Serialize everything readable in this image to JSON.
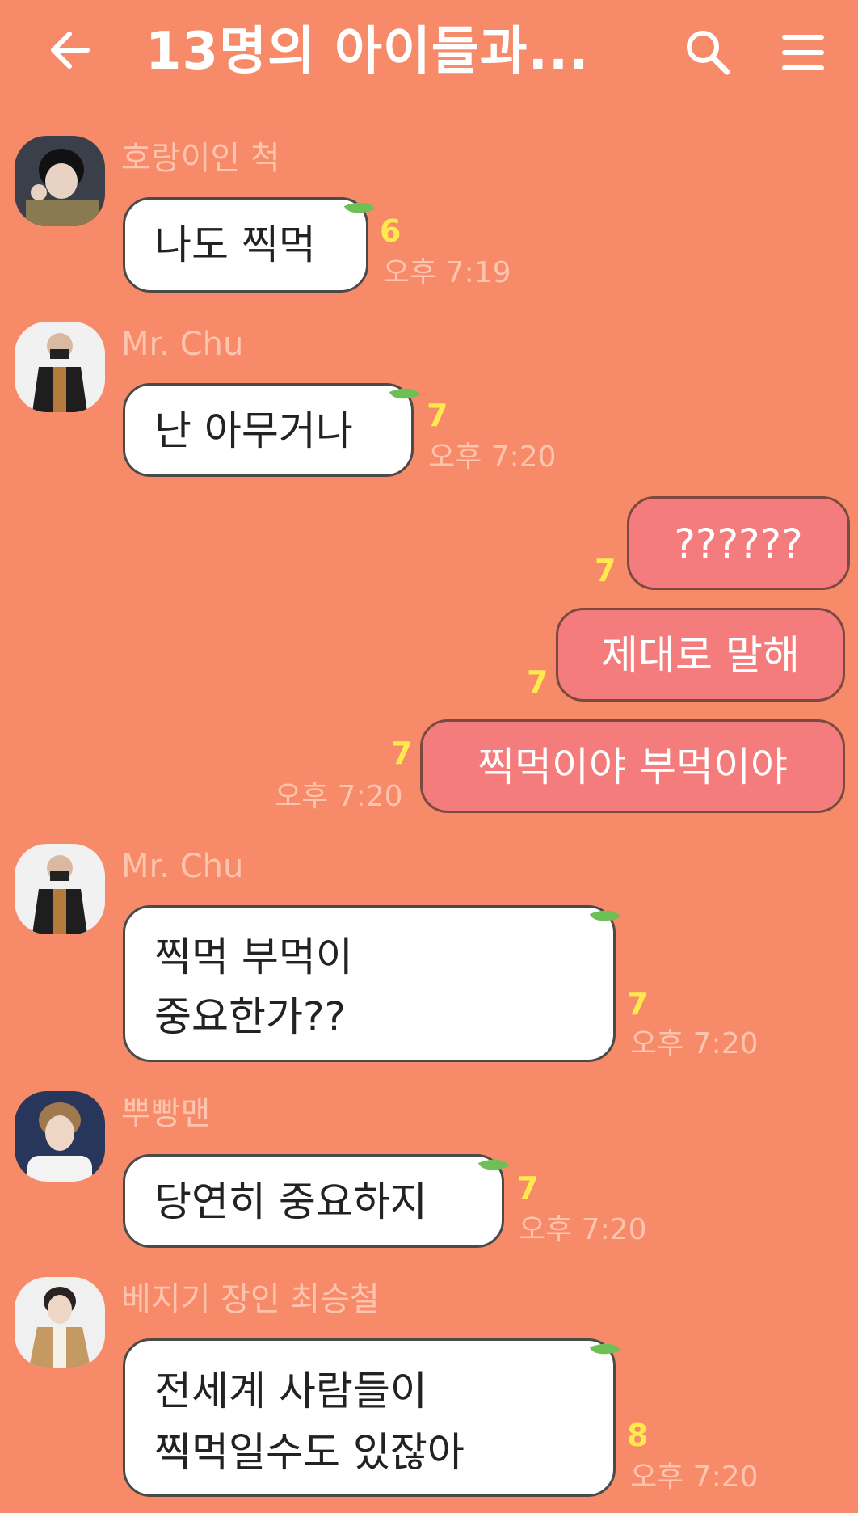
{
  "header": {
    "title": "13명의 아이들과...",
    "back_icon": "back-arrow-icon",
    "search_icon": "search-icon",
    "menu_icon": "hamburger-menu-icon"
  },
  "colors": {
    "background": "#F68A69",
    "incoming_bubble": "#FFFFFF",
    "outgoing_bubble": "#F47C7C",
    "sender_name": "#FFC4AE",
    "unread_count": "#FFE94D",
    "leaf": "#6FBF57"
  },
  "messages": [
    {
      "sender": "호랑이인 척",
      "lines": [
        "나도 찍먹"
      ],
      "unread": "6",
      "time": "오후 7:19"
    },
    {
      "sender": "Mr. Chu",
      "lines": [
        "난 아무거나"
      ],
      "unread": "7",
      "time": "오후 7:20"
    },
    {
      "lines": [
        "??????"
      ],
      "unread": "7"
    },
    {
      "lines": [
        "제대로 말해"
      ],
      "unread": "7"
    },
    {
      "lines": [
        "찍먹이야 부먹이야"
      ],
      "unread": "7",
      "time": "오후 7:20"
    },
    {
      "sender": "Mr. Chu",
      "lines": [
        "찍먹 부먹이",
        "중요한가??"
      ],
      "unread": "7",
      "time": "오후 7:20"
    },
    {
      "sender": "뿌빵맨",
      "lines": [
        "당연히 중요하지"
      ],
      "unread": "7",
      "time": "오후 7:20"
    },
    {
      "sender": "베지기 장인 최승철",
      "lines": [
        "전세계 사람들이",
        "찍먹일수도 있잖아"
      ],
      "unread": "8",
      "time": "오후 7:20"
    }
  ]
}
